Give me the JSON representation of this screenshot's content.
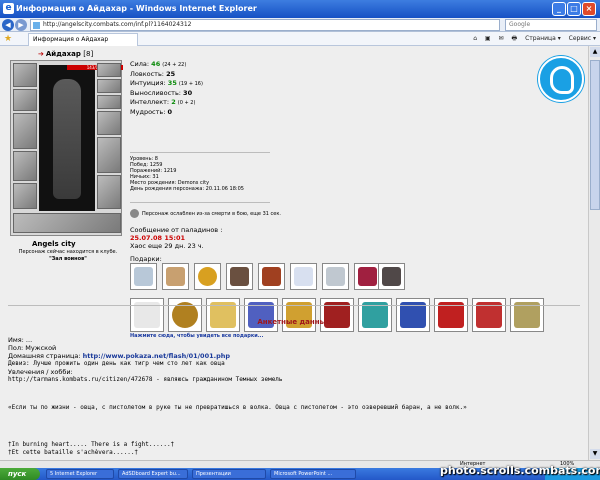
{
  "window": {
    "title": "Информация о Айдахар - Windows Internet Explorer",
    "min": "_",
    "max": "□",
    "close": "×"
  },
  "address": {
    "back": "◀",
    "fwd": "▶",
    "url": "http://angelscity.combats.com/inf.pl?1164024312",
    "search_placeholder": "Google"
  },
  "tab": {
    "label": "Информация о Айдахар"
  },
  "toolbar": {
    "items": [
      "⌂",
      "▣",
      "✉",
      "🖶",
      "Страница ▾",
      "Сервис ▾"
    ]
  },
  "character": {
    "nick": "Айдахар",
    "level": "[8]",
    "hp": "143/143",
    "city": "Angels city",
    "location_text": "Персонаж сейчас находится в клубе.",
    "location_room": "\"Зал воинов\""
  },
  "stats": [
    {
      "label": "Сила:",
      "value": "46",
      "sub": "(24 + 22)"
    },
    {
      "label": "Ловкость:",
      "value": "25",
      "sub": ""
    },
    {
      "label": "Интуиция:",
      "value": "35",
      "sub": "(19 + 16)"
    },
    {
      "label": "Выносливость:",
      "value": "30",
      "sub": ""
    },
    {
      "label": "Интеллект:",
      "value": "2",
      "sub": "(0 + 2)"
    },
    {
      "label": "Мудрость:",
      "value": "0",
      "sub": ""
    }
  ],
  "record": [
    "Уровень: 8",
    "Побед: 1259",
    "Поражений: 1219",
    "Ничьих: 31",
    "Место рождения: Demons city",
    "День рождения персонажа: 20.11.06 18:05"
  ],
  "weakness": "Персонаж ослаблен из-за смерти в бою, еще 31 сек.",
  "paladins": {
    "title": "Сообщение от паладинов :",
    "date": "25.07.08 15:01",
    "text": "Хаос еще 29 дн. 23 ч."
  },
  "gifts": {
    "label": "Подарки:",
    "link": "Нажмите сюда, чтобы увидеть все подарки..."
  },
  "anket": {
    "title": "Анкетные данные",
    "name": "Имя: ...",
    "gender": "Пол: Мужской",
    "home_label": "Домашняя страница:",
    "home_url": "http://www.pokaza.net/flash/01/001.php",
    "motto": "Девиз: Лучше прожить один день как тигр чем сто лет как овца",
    "hobby": "Увлечения / хобби:",
    "hobby_text": "http://tarmans.kombats.ru/citizen/472678 - являюсь гражданином Темных земель",
    "quote": "«Если ты по жизни - овца, с пистолетом в руке ты не превратишься в волка. Овца с пистолетом - это озверевший баран, а не волк.»",
    "heart1": "†In burning heart..... There is a fight......†",
    "heart2": "†Et cette bataille s'achèvera......†"
  },
  "status": {
    "zone": "Интернет",
    "zoom": "100%"
  },
  "taskbar": {
    "start": "пуск",
    "tasks": [
      "5 Internet Explorer",
      "AdSDboard Expert bu...",
      "Презентации",
      "Microsoft PowerPoint ..."
    ],
    "tray": "Рабочий стол"
  },
  "watermark": "photo.scrolls.combats.com"
}
